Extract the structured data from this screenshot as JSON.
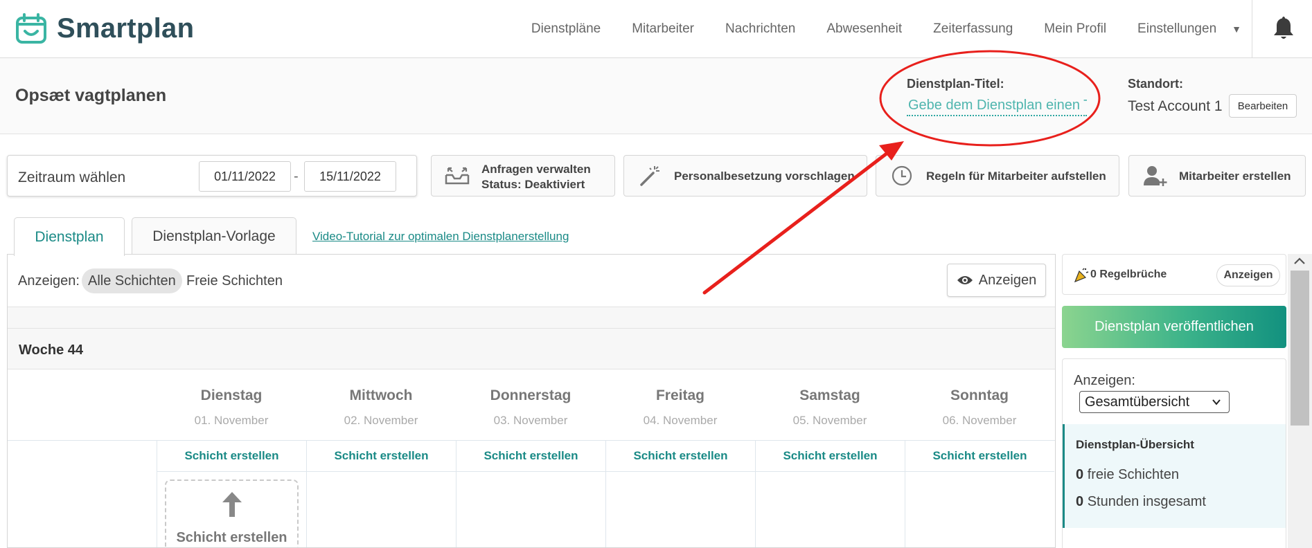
{
  "app": {
    "name": "Smartplan"
  },
  "nav": {
    "items": [
      "Dienstpläne",
      "Mitarbeiter",
      "Nachrichten",
      "Abwesenheit",
      "Zeiterfassung",
      "Mein Profil",
      "Einstellungen"
    ],
    "caret": "▼"
  },
  "page": {
    "title": "Opsæt vagtplanen",
    "schedule_title_label": "Dienstplan-Titel:",
    "schedule_title_placeholder": "Gebe dem Dienstplan einen Titel",
    "location_label": "Standort:",
    "location_value": "Test Account 1",
    "edit_label": "Bearbeiten"
  },
  "toolbar": {
    "period_label": "Zeitraum wählen",
    "date_from": "01/11/2022",
    "date_sep": "-",
    "date_to": "15/11/2022",
    "requests_label": "Anfragen verwalten",
    "requests_status": "Status: Deaktiviert",
    "staffing_label": "Personalbesetzung vorschlagen",
    "rules_label": "Regeln für Mitarbeiter aufstellen",
    "create_employee_label": "Mitarbeiter erstellen"
  },
  "tabs": {
    "schedule": "Dienstplan",
    "template": "Dienstplan-Vorlage",
    "tutorial": "Video-Tutorial zur optimalen Dienstplanerstellung"
  },
  "filter": {
    "label": "Anzeigen:",
    "all_shifts": "Alle Schichten",
    "free_shifts": "Freie Schichten",
    "show_button": "Anzeigen"
  },
  "week": {
    "title": "Woche 44",
    "days": [
      {
        "name": "Dienstag",
        "date": "01. November"
      },
      {
        "name": "Mittwoch",
        "date": "02. November"
      },
      {
        "name": "Donnerstag",
        "date": "03. November"
      },
      {
        "name": "Freitag",
        "date": "04. November"
      },
      {
        "name": "Samstag",
        "date": "05. November"
      },
      {
        "name": "Sonntag",
        "date": "06. November"
      }
    ],
    "create_shift_label": "Schicht erstellen",
    "create_card_label": "Schicht erstellen"
  },
  "sidebar": {
    "rule_violations": "0 Regelbrüche",
    "rules_show_button": "Anzeigen",
    "publish_button": "Dienstplan veröffentlichen",
    "view_label": "Anzeigen:",
    "view_selected": "Gesamtübersicht",
    "overview_title": "Dienstplan-Übersicht",
    "free_shifts_count": "0",
    "free_shifts_text": "freie Schichten",
    "hours_count": "0",
    "hours_text": "Stunden insgesamt"
  },
  "colors": {
    "accent": "#1a8a86",
    "annotation": "#e8201c",
    "publish_start": "#8bd48f",
    "publish_end": "#12917f"
  }
}
